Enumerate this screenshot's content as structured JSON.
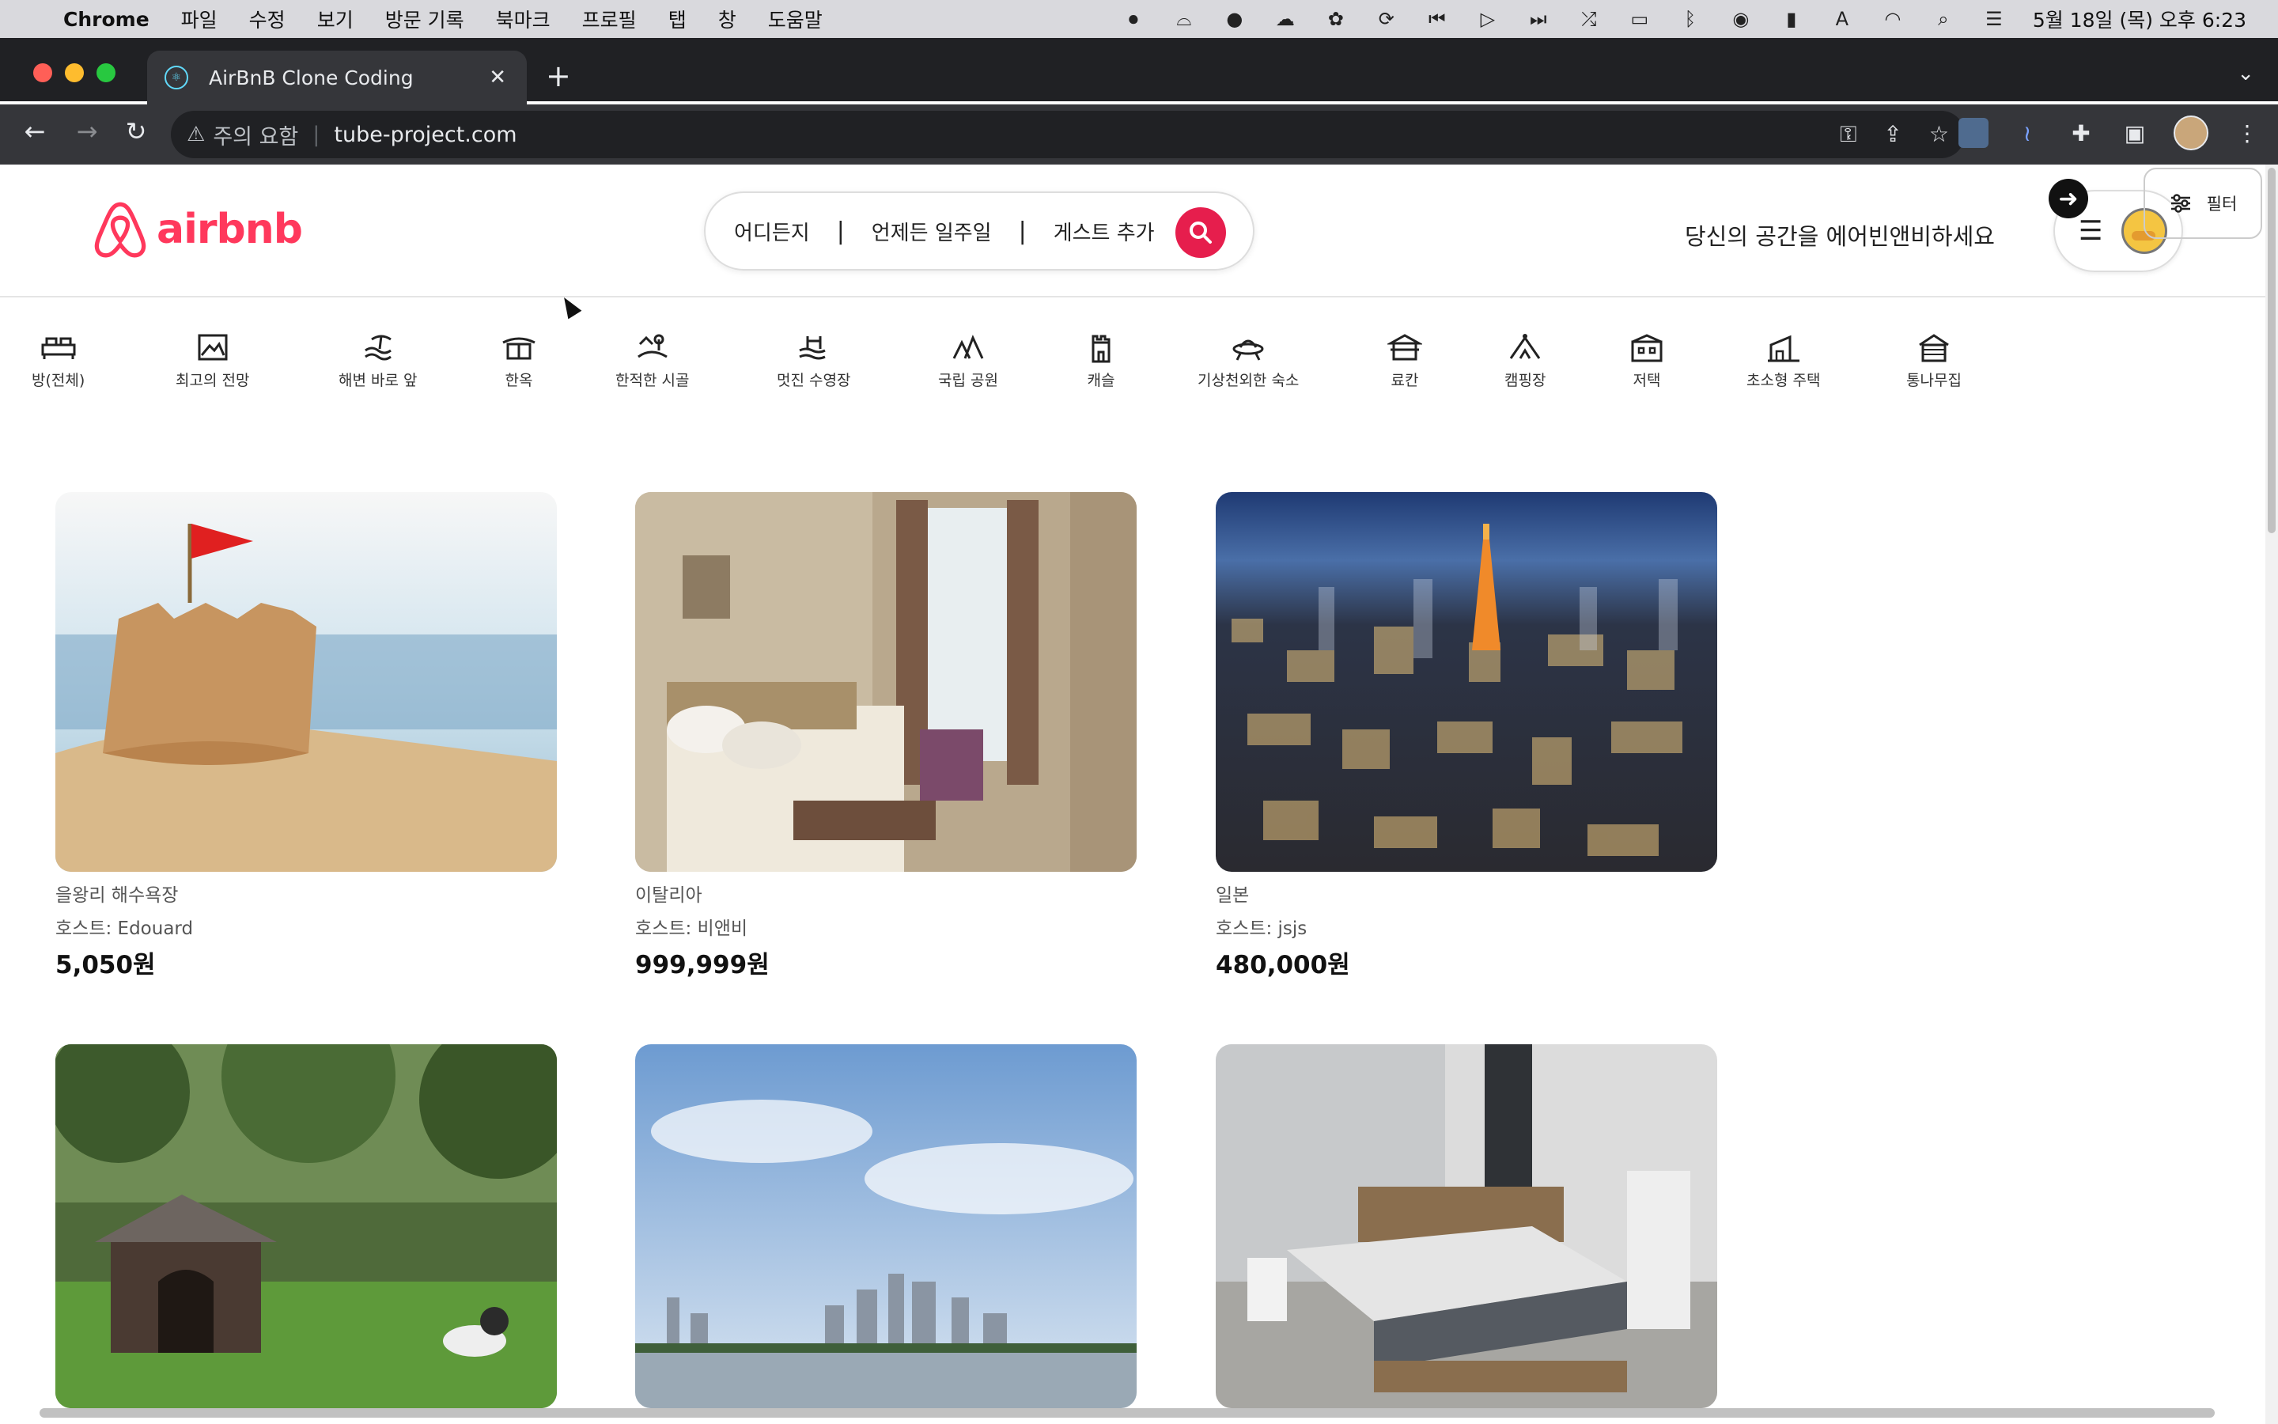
{
  "menubar": {
    "app_name": "Chrome",
    "menus": [
      "파일",
      "수정",
      "보기",
      "방문 기록",
      "북마크",
      "프로필",
      "탭",
      "창",
      "도움말"
    ],
    "clock": "5월 18일 (목) 오후 6:23",
    "input_indicator": "A"
  },
  "browser": {
    "tab_title": "AirBnB Clone Coding",
    "security_label": "주의 요함",
    "url": "tube-project.com"
  },
  "header": {
    "logo_text": "airbnb",
    "search": {
      "where": "어디든지",
      "when": "언제든 일주일",
      "guests": "게스트 추가",
      "divider": "|"
    },
    "host_link": "당신의 공간을 에어빈앤비하세요"
  },
  "categories": [
    {
      "label": "방(전체)",
      "icon": "bed-icon"
    },
    {
      "label": "최고의 전망",
      "icon": "view-frame-icon"
    },
    {
      "label": "해변 바로 앞",
      "icon": "beach-icon"
    },
    {
      "label": "한옥",
      "icon": "hanok-icon"
    },
    {
      "label": "한적한 시골",
      "icon": "countryside-icon"
    },
    {
      "label": "멋진 수영장",
      "icon": "pool-icon"
    },
    {
      "label": "국립 공원",
      "icon": "park-icon"
    },
    {
      "label": "캐슬",
      "icon": "castle-icon"
    },
    {
      "label": "기상천외한 숙소",
      "icon": "ufo-icon"
    },
    {
      "label": "료칸",
      "icon": "ryokan-icon"
    },
    {
      "label": "캠핑장",
      "icon": "camping-icon"
    },
    {
      "label": "저택",
      "icon": "mansion-icon"
    },
    {
      "label": "초소형 주택",
      "icon": "tiny-house-icon"
    },
    {
      "label": "통나무집",
      "icon": "cabin-icon"
    }
  ],
  "filter_label": "필터",
  "listings": [
    {
      "location": "을왕리 해수욕장",
      "host": "호스트: Edouard",
      "price": "5,050원",
      "image": "sandcastle-photo"
    },
    {
      "location": "이탈리아",
      "host": "호스트: 비앤비",
      "price": "999,999원",
      "image": "hotel-room-photo"
    },
    {
      "location": "일본",
      "host": "호스트: jsjs",
      "price": "480,000원",
      "image": "tokyo-night-photo"
    },
    {
      "location": "",
      "host": "",
      "price": "",
      "image": "doghouse-photo"
    },
    {
      "location": "",
      "host": "",
      "price": "",
      "image": "seoul-skyline-photo"
    },
    {
      "location": "",
      "host": "",
      "price": "",
      "image": "bedroom-photo"
    }
  ],
  "colors": {
    "brand": "#ff385c",
    "search_button": "#e61e4d",
    "browser_dark": "#202124",
    "toolbar": "#35363a"
  }
}
